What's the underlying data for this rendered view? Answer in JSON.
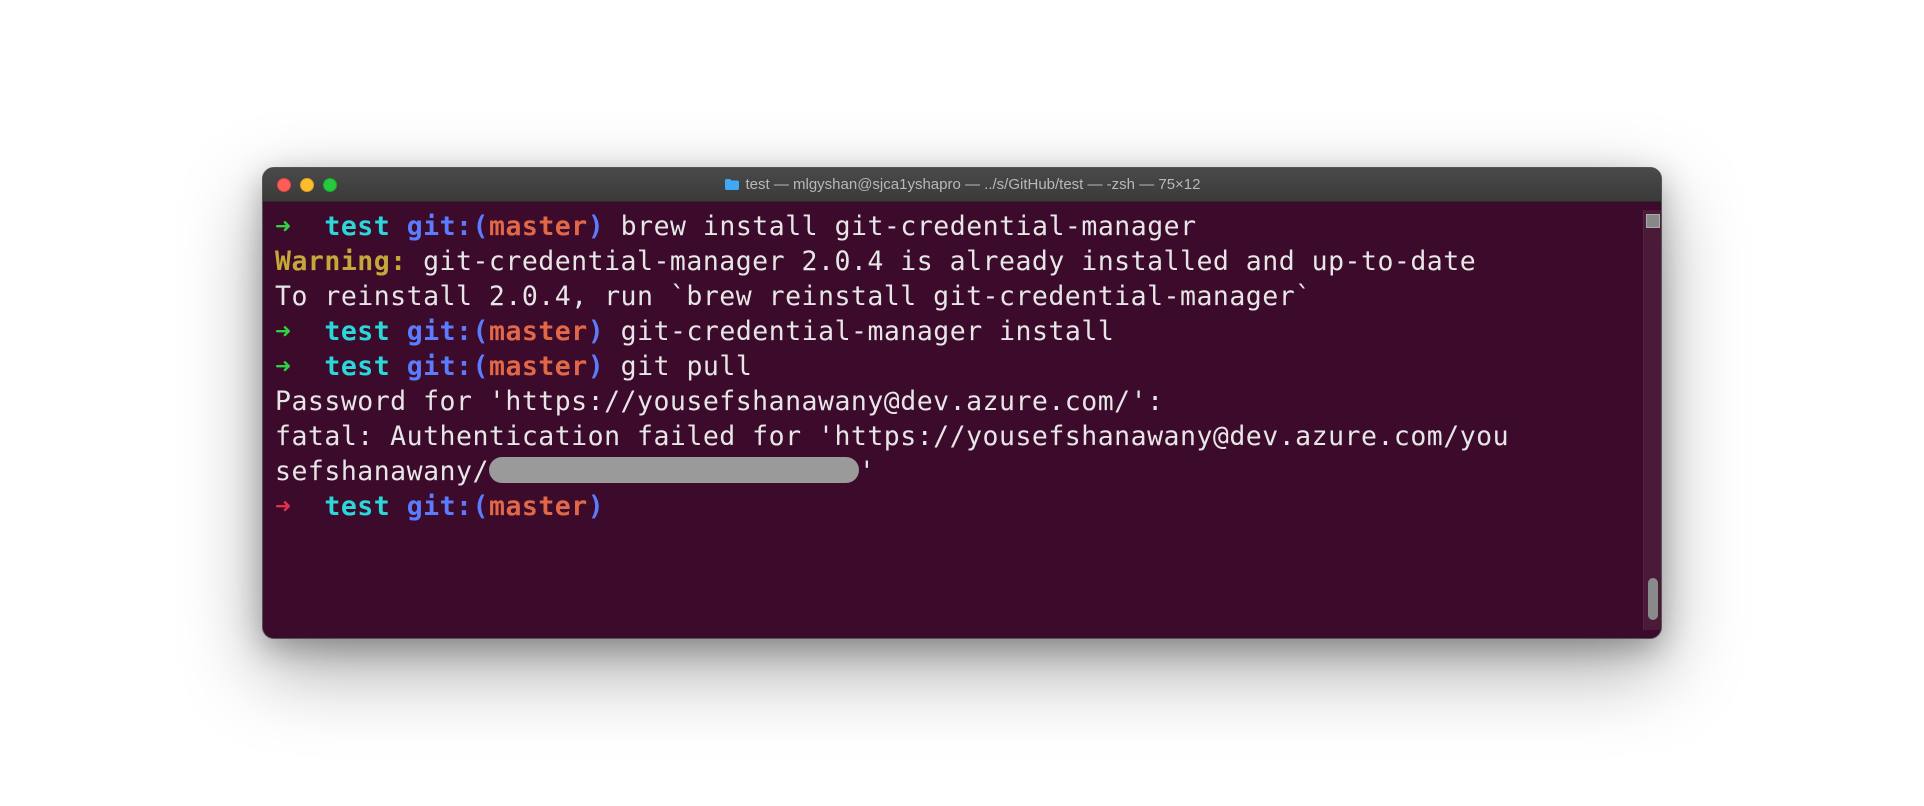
{
  "window": {
    "title": "test — mlgyshan@sjca1yshapro — ../s/GitHub/test — -zsh — 75×12"
  },
  "colors": {
    "bg": "#3c0a2b",
    "arrow_green": "#2fd141",
    "arrow_red": "#e03050",
    "dir": "#2ad7d9",
    "git": "#5c7cff",
    "branch": "#e06846",
    "warn": "#c5a83a",
    "text": "#e6e6e6"
  },
  "prompt": {
    "arrow": "➜",
    "dir": "test",
    "git_label": "git:",
    "paren_open": "(",
    "branch": "master",
    "paren_close": ")"
  },
  "lines": {
    "cmd1": "brew install git-credential-manager",
    "warn_label": "Warning:",
    "warn_text": " git-credential-manager 2.0.4 is already installed and up-to-date",
    "reinstall": "To reinstall 2.0.4, run `brew reinstall git-credential-manager`",
    "cmd2": "git-credential-manager install",
    "cmd3": "git pull",
    "password": "Password for 'https://yousefshanawany@dev.azure.com/':",
    "fatal_a": "fatal: Authentication failed for 'https://yousefshanawany@dev.azure.com/you",
    "fatal_b_prefix": "sefshanawany/",
    "fatal_b_suffix": "'"
  }
}
